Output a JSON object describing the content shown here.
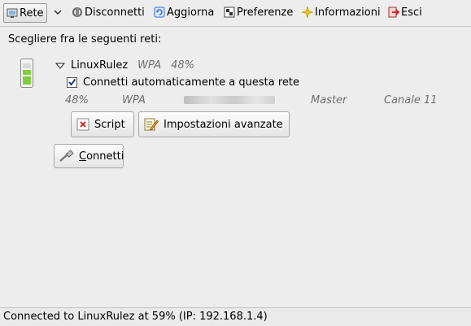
{
  "toolbar": {
    "network_label": "Rete",
    "disconnect_label": "Disconnetti",
    "refresh_label": "Aggiorna",
    "preferences_label": "Preferenze",
    "about_label": "Informazioni",
    "quit_label": "Esci"
  },
  "main": {
    "prompt": "Scegliere fra le seguenti reti:",
    "network": {
      "name": "LinuxRulez",
      "security": "WPA",
      "strength": "48%",
      "strength_value": 0.48,
      "auto_connect_label": "Connetti automaticamente a questa rete",
      "auto_connect_checked": true,
      "details": {
        "strength": "48%",
        "security": "WPA",
        "mode": "Master",
        "channel": "Canale 11"
      },
      "script_button": "Script",
      "advanced_button": "Impostazioni avanzate",
      "connect_button": "Connetti"
    }
  },
  "status": {
    "text": "Connected to LinuxRulez at 59% (IP: 192.168.1.4)"
  },
  "colors": {
    "signal_green": "#7ccf3a",
    "disconnect_red": "#c83a2a",
    "refresh_blue": "#2f6fd6",
    "about_yellow": "#f2c500",
    "quit_red": "#cc2222"
  }
}
